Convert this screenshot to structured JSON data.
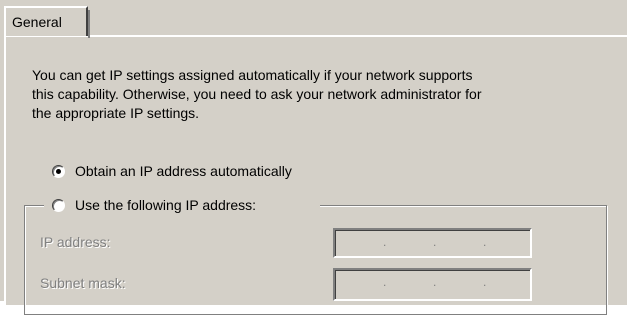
{
  "tabs": [
    {
      "label": "General"
    }
  ],
  "description_lines": [
    "You can get IP settings assigned automatically if your network supports",
    "this capability. Otherwise, you need to ask your network administrator for",
    "the appropriate IP settings."
  ],
  "obtain_auto": {
    "label": "Obtain an IP address automatically",
    "selected": true
  },
  "use_following": {
    "label": "Use the following IP address:",
    "selected": false
  },
  "fields": [
    {
      "label": "IP address:",
      "enabled": false,
      "separator": "."
    },
    {
      "label": "Subnet mask:",
      "enabled": false,
      "separator": "."
    }
  ]
}
